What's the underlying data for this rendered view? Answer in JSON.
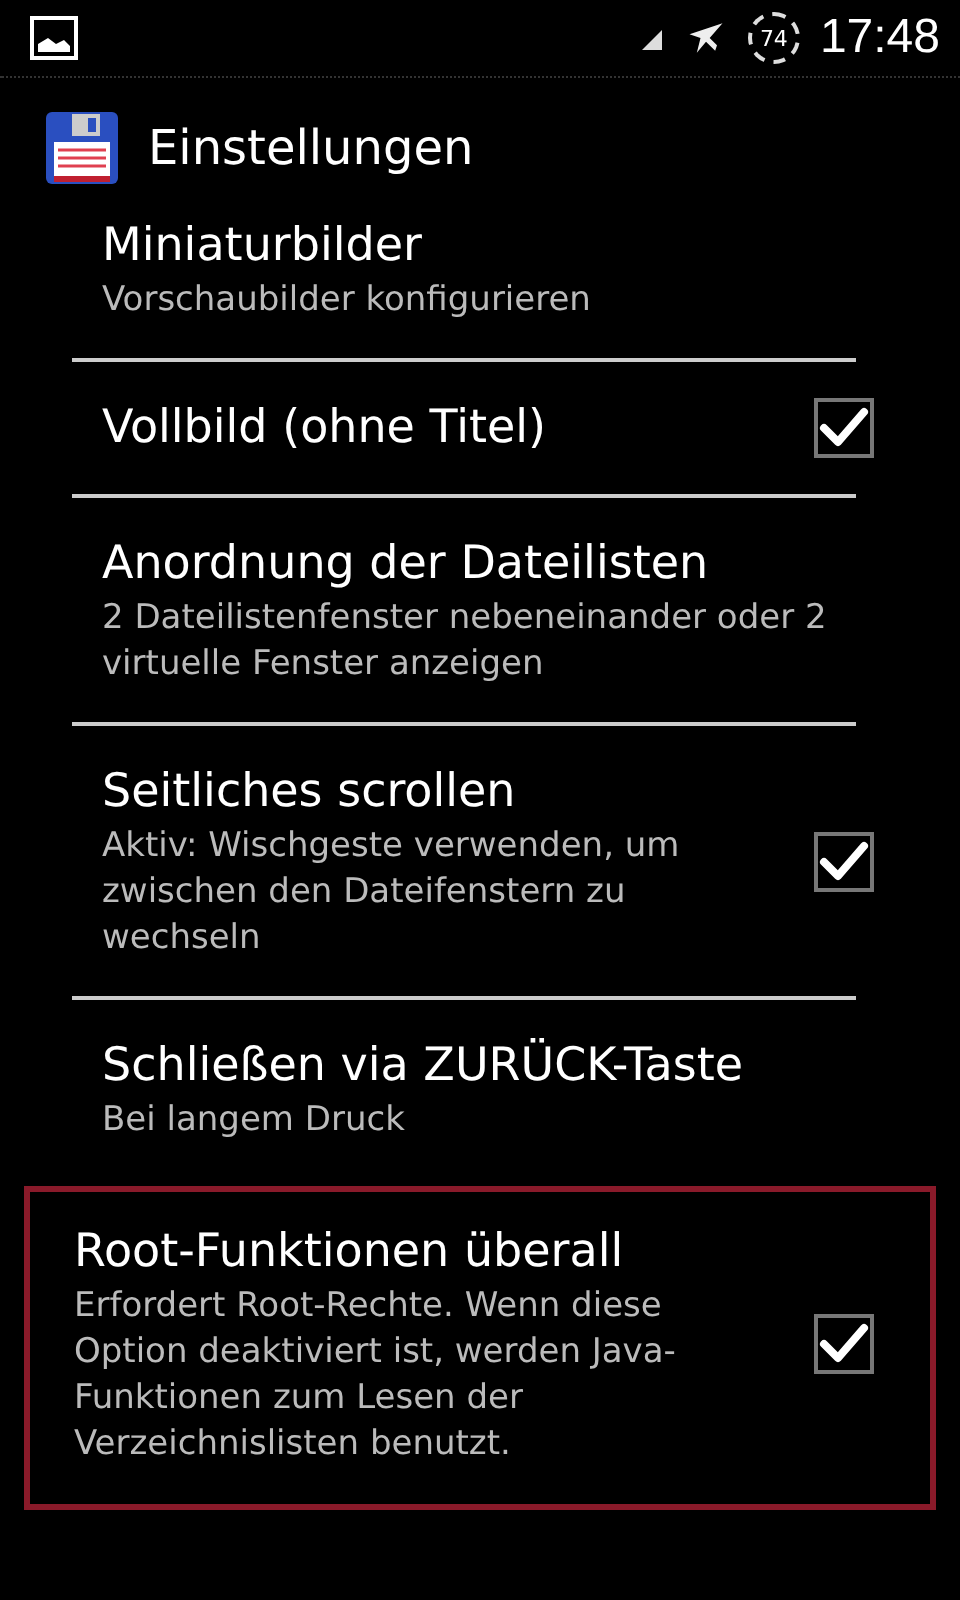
{
  "status_bar": {
    "battery": "74",
    "time": "17:48"
  },
  "app_bar": {
    "title": "Einstellungen"
  },
  "settings": [
    {
      "title": "Miniaturbilder",
      "summary": "Vorschaubilder konfigurieren",
      "cut_top": true,
      "focused": false
    },
    {
      "title": "Vollbild (ohne Titel)",
      "checked": true,
      "focused": false
    },
    {
      "title": "Anordnung der Dateilisten",
      "summary": "2 Dateilistenfenster nebeneinander oder 2 virtuelle Fenster anzeigen",
      "focused": false
    },
    {
      "title": "Seitliches scrollen",
      "summary": "Aktiv: Wischgeste verwenden, um zwischen den Dateifenstern zu wechseln",
      "checked": true,
      "focused": false
    },
    {
      "title": "Schließen via ZURÜCK-Taste",
      "summary": "Bei langem Druck",
      "focused": false
    },
    {
      "title": "Root-Funktionen überall",
      "summary": "Erfordert Root-Rechte. Wenn diese Option deaktiviert ist, werden Java-Funktionen zum Lesen der Verzeichnislisten benutzt.",
      "checked": true,
      "focused": true
    }
  ]
}
